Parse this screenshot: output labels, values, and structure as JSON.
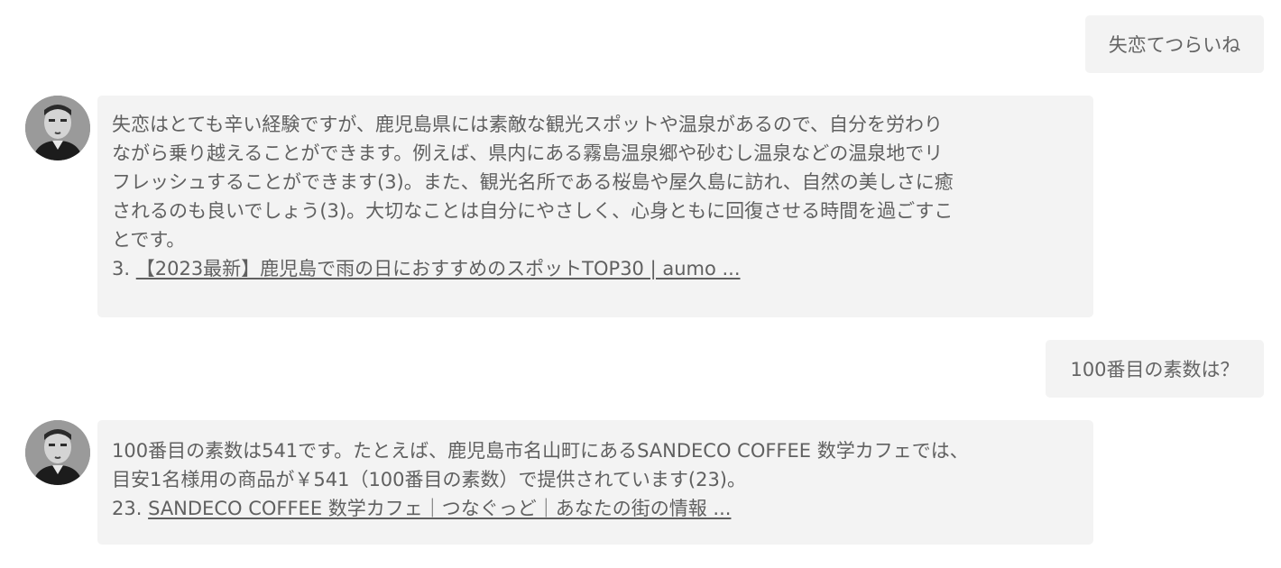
{
  "messages": [
    {
      "role": "user",
      "text": "失恋てつらいね"
    },
    {
      "role": "assistant",
      "lines": [
        "失恋はとても辛い経験ですが、鹿児島県には素敵な観光スポットや温泉があるので、自分を労わり",
        "ながら乗り越えることができます。例えば、県内にある霧島温泉郷や砂むし温泉などの温泉地でリ",
        "フレッシュすることができます(3)。また、観光名所である桜島や屋久島に訪れ、自然の美しさに癒",
        "されるのも良いでしょう(3)。大切なことは自分にやさしく、心身ともに回復させる時間を過ごすこ",
        "とです。"
      ],
      "ref_number": "3.",
      "ref_link": "【2023最新】鹿児島で雨の日におすすめのスポットTOP30 | aumo ..."
    },
    {
      "role": "user",
      "text": "100番目の素数は？"
    },
    {
      "role": "assistant",
      "lines": [
        "100番目の素数は541です。たとえば、鹿児島市名山町にあるSANDECO COFFEE 数学カフェでは、",
        "目安1名様用の商品が￥541（100番目の素数）で提供されています(23)。"
      ],
      "ref_number": "23.",
      "ref_link": "SANDECO COFFEE 数学カフェ｜つなぐっど｜あなたの街の情報 ..."
    }
  ],
  "colors": {
    "bubble_background": "#f3f3f3",
    "text": "#606060",
    "page_background": "#ffffff"
  }
}
